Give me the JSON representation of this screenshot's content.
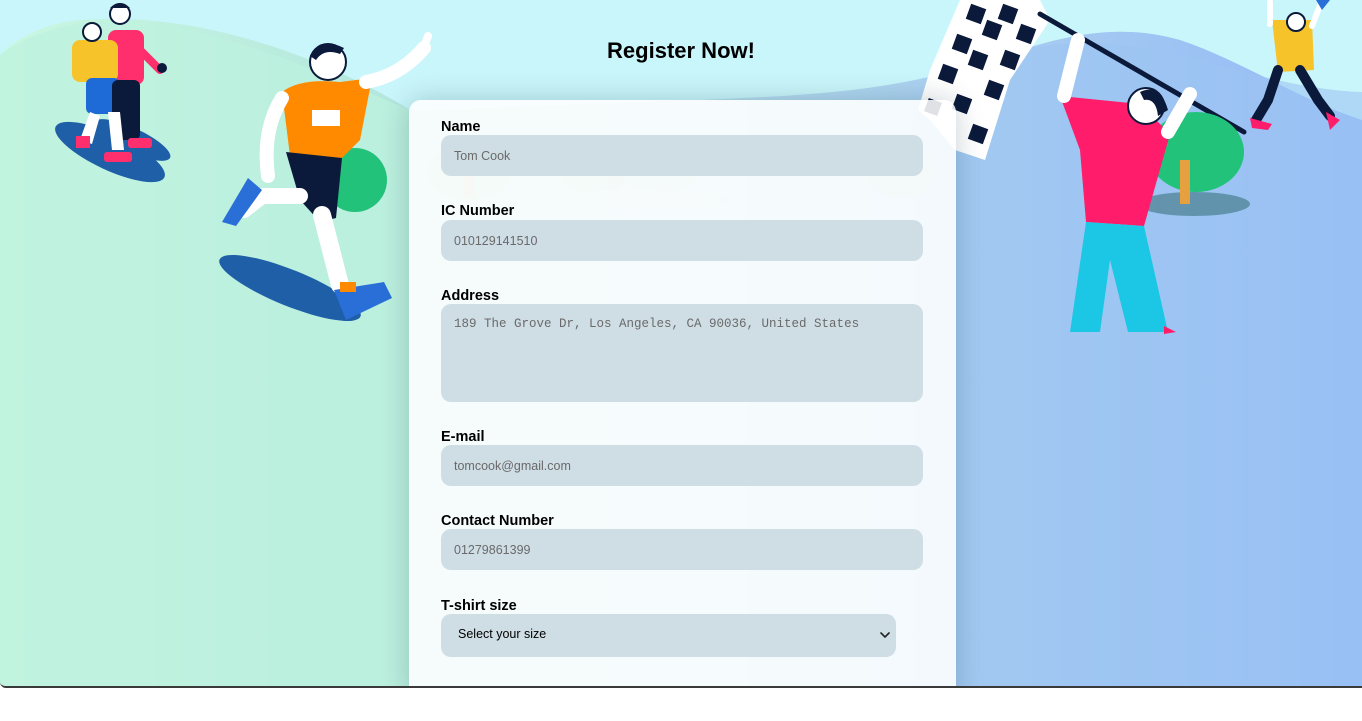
{
  "page": {
    "title": "Register Now!"
  },
  "form": {
    "name": {
      "label": "Name",
      "placeholder": "Tom Cook"
    },
    "ic_number": {
      "label": "IC Number",
      "placeholder": "010129141510"
    },
    "address": {
      "label": "Address",
      "placeholder": "189 The Grove Dr, Los Angeles, CA 90036, United States"
    },
    "email": {
      "label": "E-mail",
      "placeholder": "tomcook@gmail.com"
    },
    "contact": {
      "label": "Contact Number",
      "placeholder": "01279861399"
    },
    "tshirt": {
      "label": "T-shirt size",
      "selected": "Select your size"
    }
  },
  "illustrations": {
    "left_pair": "runner-couple-illustration",
    "left_runner": "runner-illustration",
    "right_flag": "checkered-flag-illustration",
    "right_person": "flag-waver-illustration",
    "right_runner": "small-runner-illustration",
    "tree": "tree-illustration"
  },
  "colors": {
    "accent_orange": "#ff8a00",
    "accent_pink": "#ff1c6a",
    "accent_blue": "#2a6fd8",
    "field_bg": "#cfdde5"
  }
}
